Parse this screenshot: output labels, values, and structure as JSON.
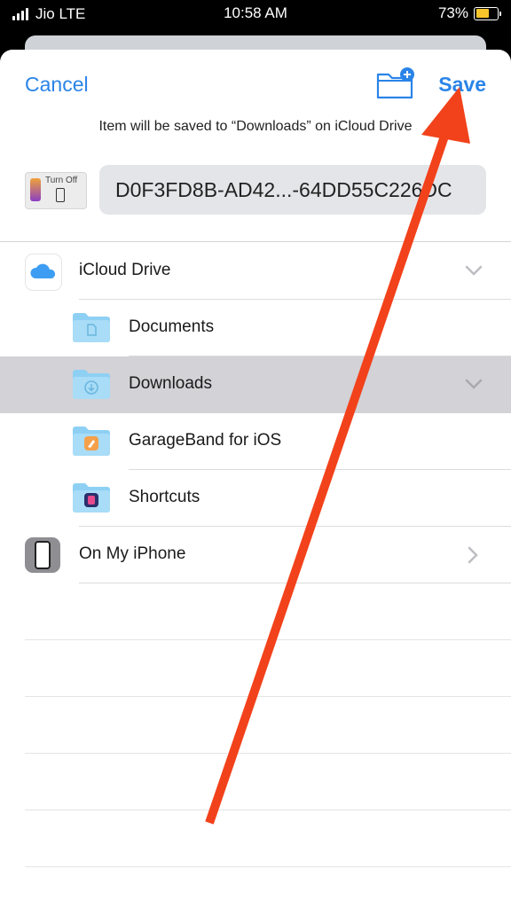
{
  "status_bar": {
    "carrier": "Jio LTE",
    "time": "10:58 AM",
    "battery_percent": "73%",
    "battery_level": 0.73,
    "battery_color": "#f7c52a"
  },
  "nav": {
    "cancel_label": "Cancel",
    "save_label": "Save",
    "new_folder_icon": "folder-plus-icon",
    "accent_color": "#2a84e8"
  },
  "save_info": "Item will be saved to “Downloads” on iCloud Drive",
  "file": {
    "name": "D0F3FD8B-AD42...-64DD55C226DC",
    "thumbnail_text": "Turn Off"
  },
  "locations": [
    {
      "label": "iCloud Drive",
      "icon": "icloud-icon",
      "chevron": "chevron-down-icon"
    },
    {
      "label": "Documents",
      "icon": "folder-icon"
    },
    {
      "label": "Downloads",
      "icon": "downloads-folder-icon",
      "chevron": "chevron-down-icon",
      "selected": true
    },
    {
      "label": "GarageBand for iOS",
      "icon": "garageband-folder-icon"
    },
    {
      "label": "Shortcuts",
      "icon": "shortcuts-folder-icon"
    },
    {
      "label": "On My iPhone",
      "icon": "iphone-icon",
      "chevron": "chevron-right-icon"
    }
  ],
  "annotation": {
    "arrow_color": "#f2421b",
    "points_to": "save-button"
  }
}
